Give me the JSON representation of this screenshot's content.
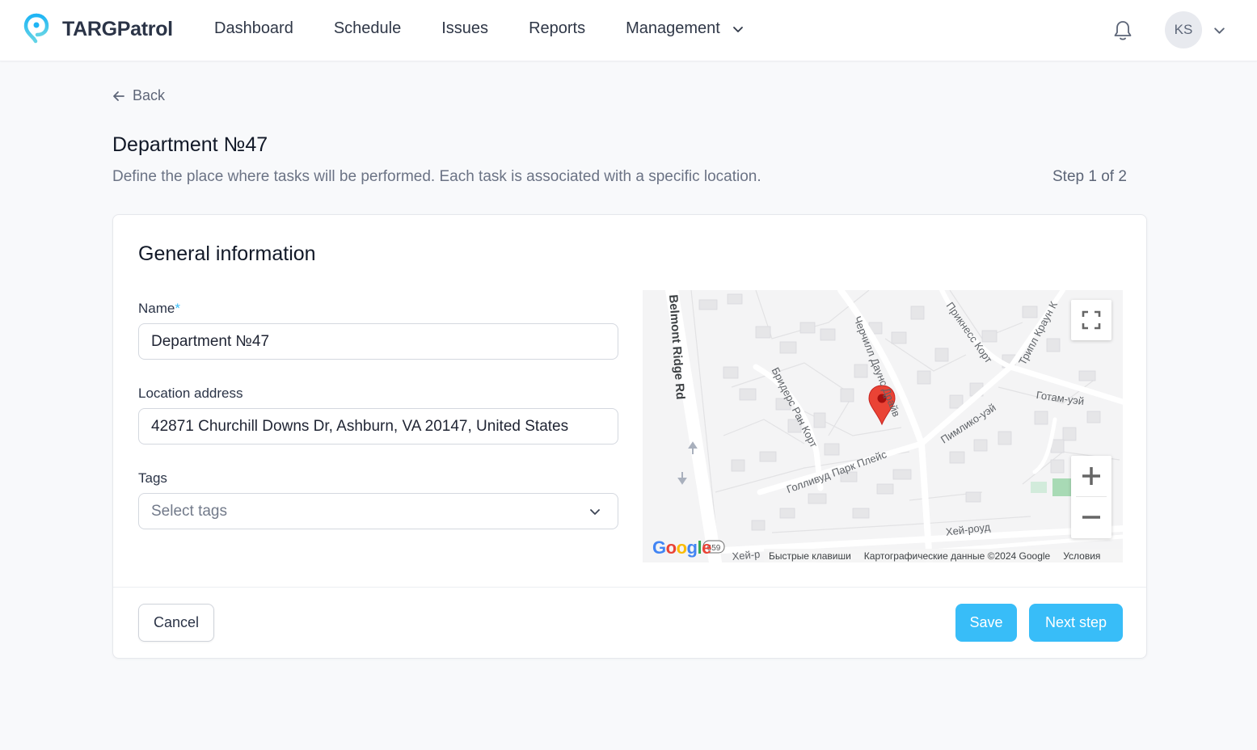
{
  "brand": {
    "name": "TARGPatrol",
    "accent": "#38bdf8"
  },
  "nav": {
    "items": [
      {
        "label": "Dashboard"
      },
      {
        "label": "Schedule"
      },
      {
        "label": "Issues"
      },
      {
        "label": "Reports"
      },
      {
        "label": "Management",
        "has_dropdown": true
      }
    ]
  },
  "header": {
    "notifications_icon": "bell-icon",
    "user_initials": "KS"
  },
  "page": {
    "back_label": "Back",
    "title": "Department №47",
    "subtitle": "Define the place where tasks will be performed. Each task is associated with a specific location.",
    "step": "Step 1 of 2"
  },
  "form": {
    "section_title": "General information",
    "name": {
      "label": "Name",
      "required_mark": "*",
      "value": "Department №47"
    },
    "address": {
      "label": "Location address",
      "value": "42871 Churchill Downs Dr, Ashburn, VA 20147, United States"
    },
    "tags": {
      "label": "Tags",
      "placeholder": "Select tags"
    }
  },
  "map": {
    "streets": [
      "Belmont Ridge Rd",
      "Бридерс Ран Корт",
      "Черчилл Даунс Драйв",
      "Прикнесс Корт",
      "Трипл Краун К",
      "Готам-уэй",
      "Пимлико-уэй",
      "Голливуд Парк Плейс",
      "Хей-роуд",
      "Хей-р"
    ],
    "route_badge": "659",
    "attribution": {
      "shortcuts": "Быстрые клавиши",
      "data": "Картографические данные ©2024 Google",
      "terms": "Условия"
    },
    "google_letters": [
      "G",
      "o",
      "o",
      "g",
      "l",
      "e"
    ],
    "google_colors": [
      "#4285F4",
      "#EA4335",
      "#FBBC05",
      "#4285F4",
      "#34A853",
      "#EA4335"
    ],
    "marker_color": "#ea4335"
  },
  "actions": {
    "cancel": "Cancel",
    "save": "Save",
    "next": "Next step"
  }
}
